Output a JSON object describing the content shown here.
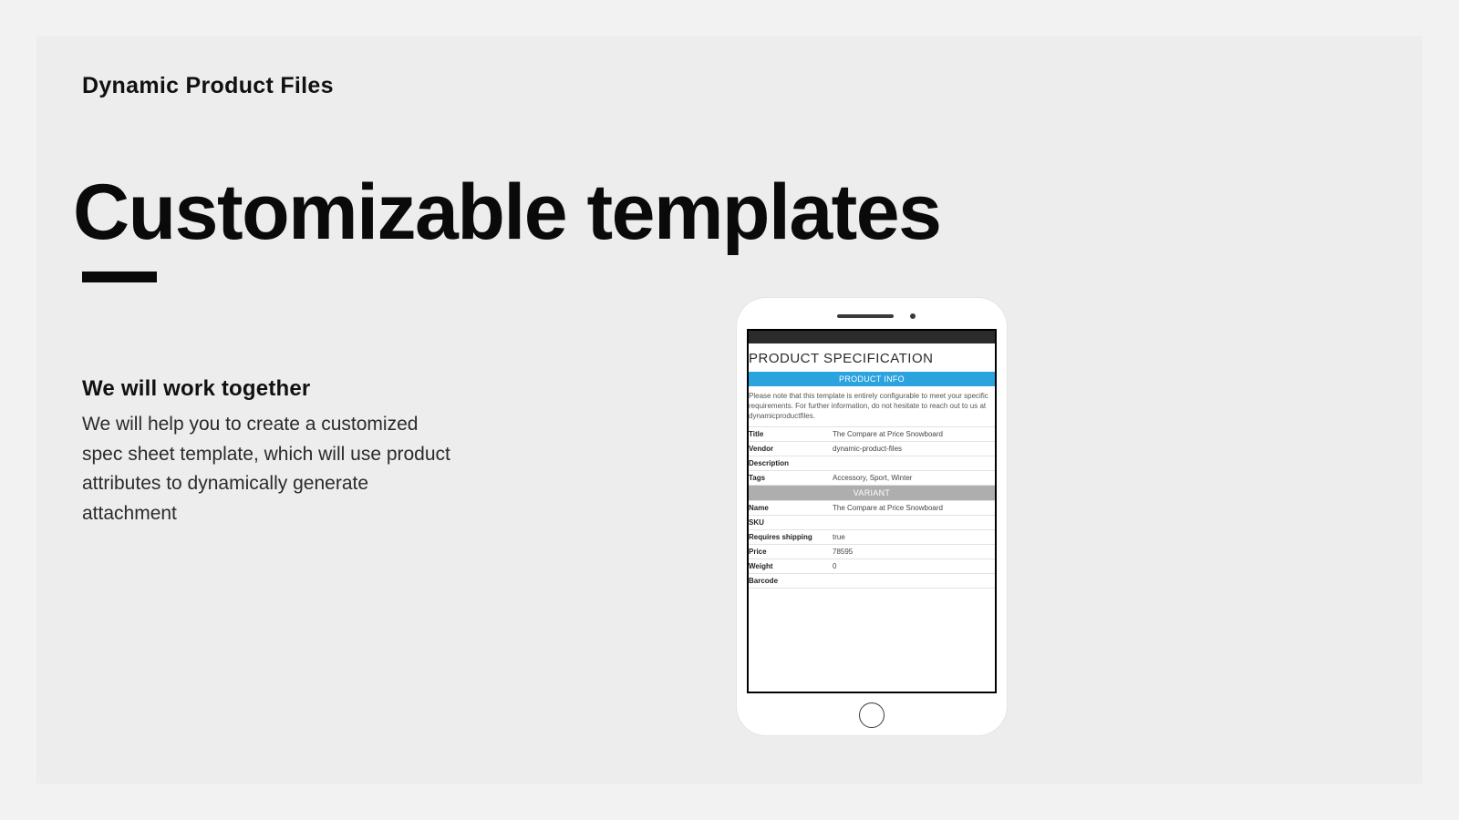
{
  "brand": "Dynamic Product Files",
  "headline": "Customizable templates",
  "subhead": "We will work together",
  "body": "We will help you to create a customized spec sheet template, which will use product attributes to dynamically generate attachment",
  "spec": {
    "title": "PRODUCT SPECIFICATION",
    "section_info": "PRODUCT INFO",
    "note": "Please note that this template is entirely configurable to meet your specific requirements. For further information, do not hesitate to reach out to us at dynamicproductfiles.",
    "info_rows": [
      {
        "k": "Title",
        "v": "The Compare at Price Snowboard"
      },
      {
        "k": "Vendor",
        "v": "dynamic-product-files"
      },
      {
        "k": "Description",
        "v": ""
      },
      {
        "k": "Tags",
        "v": "Accessory, Sport, Winter"
      }
    ],
    "section_variant": "VARIANT",
    "variant_rows": [
      {
        "k": "Name",
        "v": "The Compare at Price Snowboard"
      },
      {
        "k": "SKU",
        "v": ""
      },
      {
        "k": "Requires shipping",
        "v": "true"
      },
      {
        "k": "Price",
        "v": "78595"
      },
      {
        "k": "Weight",
        "v": "0"
      },
      {
        "k": "Barcode",
        "v": ""
      }
    ]
  }
}
